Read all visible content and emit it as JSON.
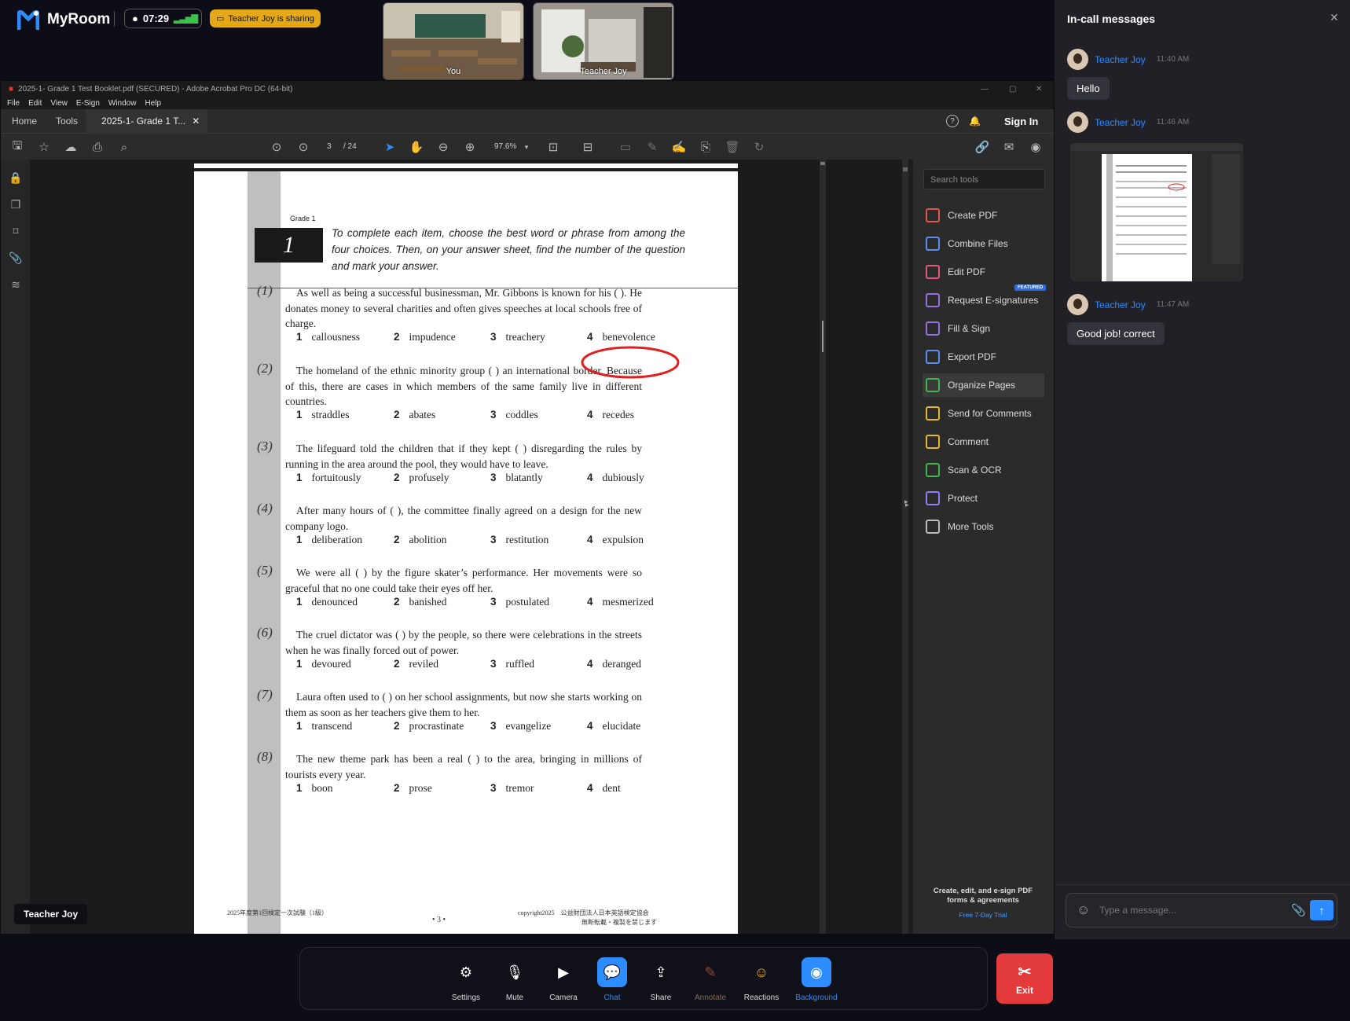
{
  "app": {
    "name": "MyRoom",
    "timer": "07:29",
    "sharing_badge": "Teacher Joy is sharing"
  },
  "tiles": [
    {
      "label": "You"
    },
    {
      "label": "Teacher Joy"
    }
  ],
  "acrobat": {
    "window_title": "2025-1- Grade 1 Test Booklet.pdf (SECURED) - Adobe Acrobat Pro DC (64-bit)",
    "menu": [
      "File",
      "Edit",
      "View",
      "E-Sign",
      "Window",
      "Help"
    ],
    "tabs": {
      "home": "Home",
      "tools": "Tools",
      "doc": "2025-1- Grade 1 T..."
    },
    "sign_in": "Sign In",
    "page_current": "3",
    "page_total": "/ 24",
    "zoom": "97.6%",
    "search_tools_placeholder": "Search tools",
    "tools": [
      "Create PDF",
      "Combine Files",
      "Edit PDF",
      "Request E-signatures",
      "Fill & Sign",
      "Export PDF",
      "Organize Pages",
      "Send for Comments",
      "Comment",
      "Scan & OCR",
      "Protect",
      "More Tools"
    ],
    "featured_badge": "FEATURED",
    "promo_line1": "Create, edit, and e-sign PDF",
    "promo_line2": "forms & agreements",
    "promo_link": "Free 7-Day Trial",
    "presenter_label": "Teacher Joy"
  },
  "document": {
    "grade_label": "Grade 1",
    "section_number": "1",
    "instructions": "To complete each item, choose the best word or phrase from among the four choices. Then, on your answer sheet, find the number of the question and mark your answer.",
    "questions": [
      {
        "num": "(1)",
        "text": "As well as being a successful businessman, Mr. Gibbons is known for his (        ). He donates money to several charities and often gives speeches at local schools free of charge.",
        "choices": [
          "callousness",
          "impudence",
          "treachery",
          "benevolence"
        ]
      },
      {
        "num": "(2)",
        "text": "The homeland of the ethnic minority group (        ) an international border. Because of this, there are cases in which members of the same family live in different countries.",
        "choices": [
          "straddles",
          "abates",
          "coddles",
          "recedes"
        ]
      },
      {
        "num": "(3)",
        "text": "The lifeguard told the children that if they kept (        ) disregarding the rules by running in the area around the pool, they would have to leave.",
        "choices": [
          "fortuitously",
          "profusely",
          "blatantly",
          "dubiously"
        ]
      },
      {
        "num": "(4)",
        "text": "After many hours of (        ), the committee finally agreed on a design for the new company logo.",
        "choices": [
          "deliberation",
          "abolition",
          "restitution",
          "expulsion"
        ]
      },
      {
        "num": "(5)",
        "text": "We were all (        ) by the figure skater’s performance. Her movements were so graceful that no one could take their eyes off her.",
        "choices": [
          "denounced",
          "banished",
          "postulated",
          "mesmerized"
        ]
      },
      {
        "num": "(6)",
        "text": "The cruel dictator was (        ) by the people, so there were celebrations in the streets when he was finally forced out of power.",
        "choices": [
          "devoured",
          "reviled",
          "ruffled",
          "deranged"
        ]
      },
      {
        "num": "(7)",
        "text": "Laura often used to (        ) on her school assignments, but now she starts working on them as soon as her teachers give them to her.",
        "choices": [
          "transcend",
          "procrastinate",
          "evangelize",
          "elucidate"
        ]
      },
      {
        "num": "(8)",
        "text": "The new theme park has been a real (        ) to the area, bringing in millions of tourists every year.",
        "choices": [
          "boon",
          "prose",
          "tremor",
          "dent"
        ]
      }
    ],
    "footer_left": "2025年度第1回検定一次試験（1級）",
    "footer_page": "• 3 •",
    "footer_right_1": "copyright2025　公益財団法人日本英語検定協会",
    "footer_right_2": "無断転載・複製を禁じます"
  },
  "chat": {
    "title": "In-call messages",
    "messages": [
      {
        "sender": "Teacher Joy",
        "time": "11:40 AM",
        "text": "Hello"
      },
      {
        "sender": "Teacher Joy",
        "time": "11:46 AM",
        "text": ""
      },
      {
        "sender": "Teacher Joy",
        "time": "11:47 AM",
        "text": "Good job! correct"
      }
    ],
    "input_placeholder": "Type a message..."
  },
  "controls": [
    "Settings",
    "Mute",
    "Camera",
    "Chat",
    "Share",
    "Annotate",
    "Reactions",
    "Background"
  ],
  "exit_label": "Exit",
  "colors": {
    "accent": "#2d8cff",
    "exit": "#e33b3b",
    "sharing": "#e5a817",
    "circle": "#e02020"
  }
}
